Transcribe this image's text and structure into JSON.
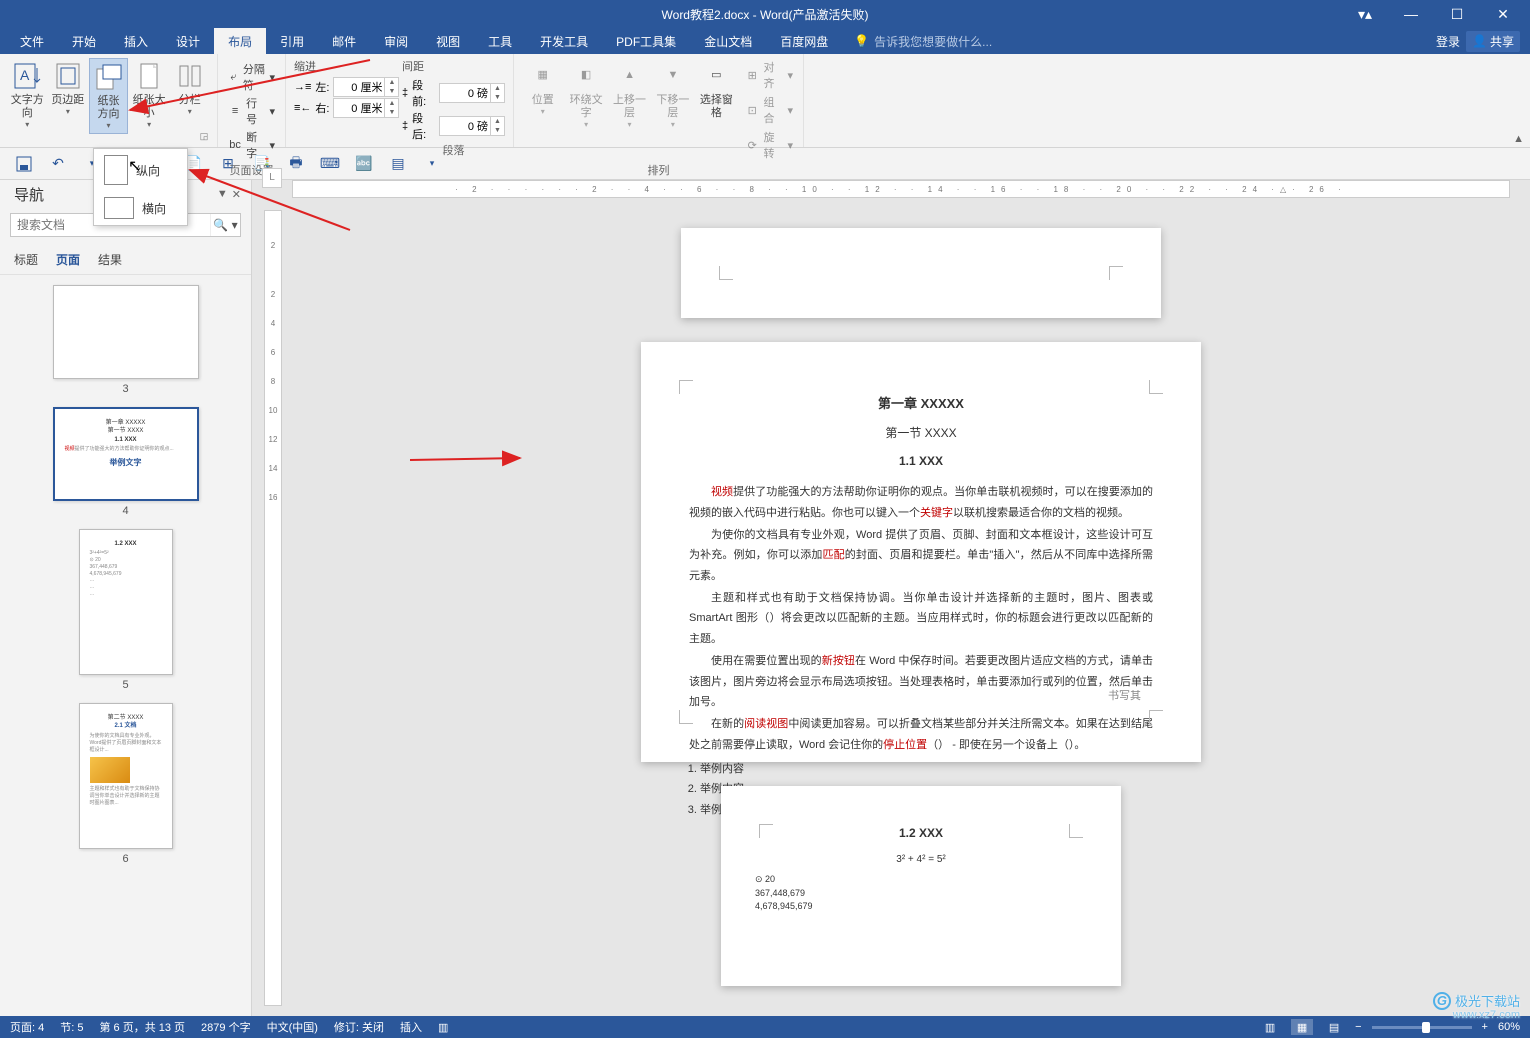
{
  "title": "Word教程2.docx - Word(产品激活失败)",
  "window_controls": {
    "opts": "⚙",
    "min": "—",
    "max": "☐",
    "close": "✕"
  },
  "menu": {
    "tabs": [
      "文件",
      "开始",
      "插入",
      "设计",
      "布局",
      "引用",
      "邮件",
      "审阅",
      "视图",
      "工具",
      "开发工具",
      "PDF工具集",
      "金山文档",
      "百度网盘"
    ],
    "active_index": 4,
    "tellme_placeholder": "告诉我您想要做什么...",
    "login": "登录",
    "share": "共享"
  },
  "ribbon": {
    "g1": {
      "textdir": "文字方向",
      "margins": "页边距",
      "orient": "纸张方向",
      "size": "纸张大小",
      "columns": "分栏",
      "breaks": "分隔符",
      "linenum": "行号",
      "hyphen": "断字",
      "label": "页面设置"
    },
    "g2": {
      "title": "缩进",
      "left_label": "左:",
      "right_label": "右:",
      "left_val": "0 厘米",
      "right_val": "0 厘米"
    },
    "g3": {
      "title": "间距",
      "before_label": "段前:",
      "after_label": "段后:",
      "before_val": "0 磅",
      "after_val": "0 磅",
      "label": "段落"
    },
    "g4": {
      "position": "位置",
      "wrap": "环绕文字",
      "forward": "上移一层",
      "backward": "下移一层",
      "selpane": "选择窗格",
      "align": "对齐",
      "group": "组合",
      "rotate": "旋转",
      "label": "排列"
    }
  },
  "orient_dropdown": {
    "portrait": "纵向",
    "landscape": "横向"
  },
  "qat": {
    "save": "💾",
    "undo": "↶",
    "redo": "↷"
  },
  "nav": {
    "title": "导航",
    "search_placeholder": "搜索文档",
    "tabs": [
      "标题",
      "页面",
      "结果"
    ],
    "active_tab": 1,
    "thumbs": [
      {
        "num": "3",
        "orient": "land",
        "selected": false
      },
      {
        "num": "4",
        "orient": "land",
        "selected": true
      },
      {
        "num": "5",
        "orient": "port",
        "selected": false
      },
      {
        "num": "6",
        "orient": "port",
        "selected": false
      }
    ]
  },
  "doc": {
    "chapter": "第一章 XXXXX",
    "section": "第一节 XXXX",
    "sub": "1.1 XXX",
    "p1a": "视频",
    "p1b": "提供了功能强大的方法帮助你证明你的观点。当你单击联机视频时，可以在搜要添加的视频的嵌入代码中进行粘贴。你也可以键入一个",
    "p1c": "关键字",
    "p1d": "以联机搜索最适合你的文档的视频。",
    "p2a": "为使你的文档具有专业外观，Word 提供了页眉、页脚、封面和文本框设计，这些设计可互为补充。例如，你可以添加",
    "p2b": "匹配",
    "p2c": "的封面、页眉和提要栏。单击\"插入\"，然后从不同库中选择所需 元素。",
    "p3": "主题和样式也有助于文档保持协调。当你单击设计并选择新的主题时，图片、图表或 SmartArt 图形（）将会更改以匹配新的主题。当应用样式时，你的标题会进行更改以匹配新的主题。",
    "p4a": "使用在需要位置出现的",
    "p4b": "新按钮",
    "p4c": "在 Word 中保存时间。若要更改图片适应文档的方式，请单击该图片，图片旁边将会显示布局选项按钮。当处理表格时，单击要添加行或列的位置，然后单击加号。",
    "p5a": "在新的",
    "p5b": "阅读视图",
    "p5c": "中阅读更加容易。可以折叠文档某些部分并关注所需文本。如果在达到结尾处之前需要停止读取，Word 会记住你的",
    "p5d": "停止位置",
    "p5e": "（） - 即使在另一个设备上（）。",
    "list": [
      "举例内容",
      "举例内容",
      "举例内容"
    ],
    "example": "举例文字",
    "sig": "书写其",
    "next_sub": "1.2 XXX",
    "formula": "3² + 4² = 5²",
    "nums": [
      "⊙  20",
      "367,448,679",
      "4,678,945,679"
    ]
  },
  "status": {
    "page": "页面: 4",
    "section": "节: 5",
    "pages": "第 6 页，共 13 页",
    "words": "2879 个字",
    "lang": "中文(中国)",
    "track": "修订: 关闭",
    "insert": "插入",
    "zoom": "60%"
  },
  "watermark": {
    "name": "极光下载站",
    "url": "www.xz7.com"
  }
}
